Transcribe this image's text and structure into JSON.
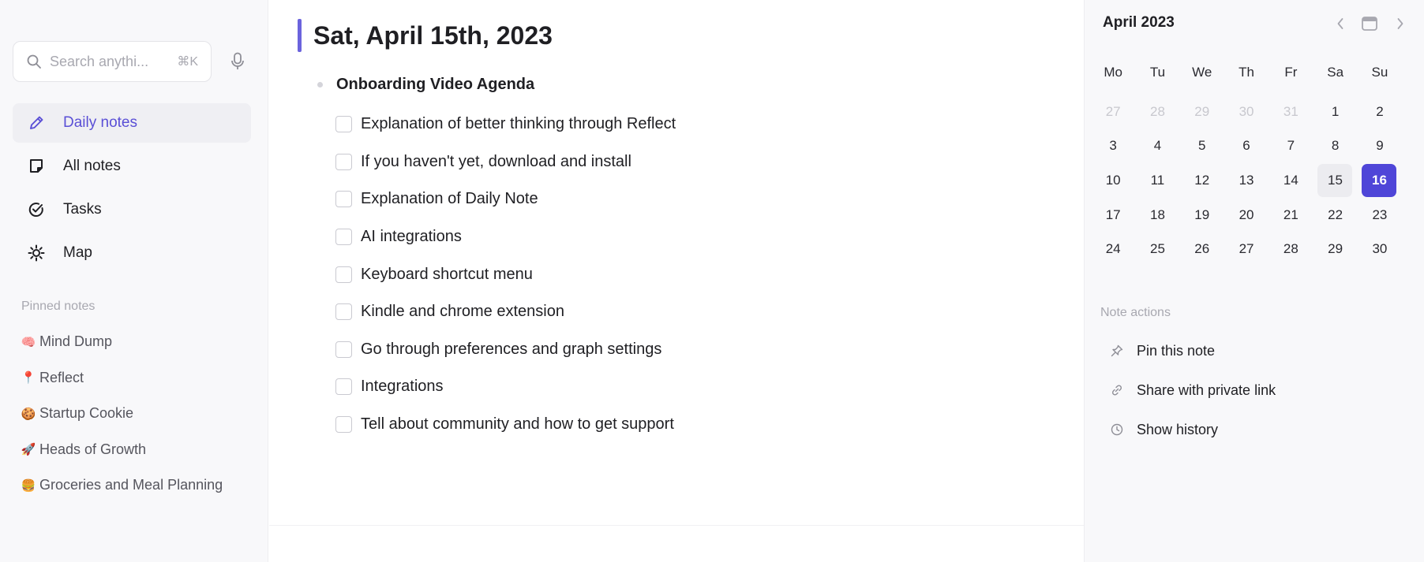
{
  "search": {
    "placeholder": "Search anythi...",
    "shortcut": "⌘K"
  },
  "sidebar": {
    "nav": [
      {
        "label": "Daily notes",
        "icon": "pencil-icon",
        "active": true
      },
      {
        "label": "All notes",
        "icon": "note-icon",
        "active": false
      },
      {
        "label": "Tasks",
        "icon": "check-circle-icon",
        "active": false
      },
      {
        "label": "Map",
        "icon": "map-icon",
        "active": false
      }
    ],
    "pinned_title": "Pinned notes",
    "pinned": [
      {
        "emoji": "🧠",
        "label": "Mind Dump"
      },
      {
        "emoji": "📍",
        "label": "Reflect"
      },
      {
        "emoji": "🍪",
        "label": "Startup Cookie"
      },
      {
        "emoji": "🚀",
        "label": "Heads of Growth"
      },
      {
        "emoji": "🍔",
        "label": "Groceries and Meal Planning"
      }
    ]
  },
  "note": {
    "title": "Sat, April 15th, 2023",
    "heading": "Onboarding Video Agenda",
    "tasks": [
      "Explanation of better thinking through Reflect",
      "If you haven't yet, download and install",
      "Explanation of Daily Note",
      "AI integrations",
      "Keyboard shortcut menu",
      "Kindle and chrome extension",
      "Go through preferences and graph settings",
      "Integrations",
      "Tell about community and how to get support"
    ]
  },
  "calendar": {
    "month": "April 2023",
    "weekdays": [
      "Mo",
      "Tu",
      "We",
      "Th",
      "Fr",
      "Sa",
      "Su"
    ],
    "weeks": [
      [
        "27",
        "28",
        "29",
        "30",
        "31",
        "1",
        "2"
      ],
      [
        "3",
        "4",
        "5",
        "6",
        "7",
        "8",
        "9"
      ],
      [
        "10",
        "11",
        "12",
        "13",
        "14",
        "15",
        "16"
      ],
      [
        "17",
        "18",
        "19",
        "20",
        "21",
        "22",
        "23"
      ],
      [
        "24",
        "25",
        "26",
        "27",
        "28",
        "29",
        "30"
      ]
    ],
    "muted_count_first_week": 5,
    "current_day": "15",
    "selected_day": "16",
    "accent": "#4f46d8"
  },
  "note_actions": {
    "title": "Note actions",
    "items": [
      {
        "label": "Pin this note",
        "icon": "pin-icon"
      },
      {
        "label": "Share with private link",
        "icon": "link-icon"
      },
      {
        "label": "Show history",
        "icon": "clock-icon"
      }
    ]
  }
}
